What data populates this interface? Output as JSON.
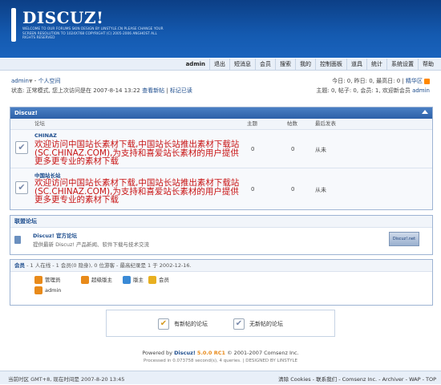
{
  "logo": {
    "text": "DISCUZ!",
    "sub": "WELCOME TO OUR FORUMS  SKIN DESIGN BY LINSTYLE.CN  PLEASE CHANGE YOUR SCREEN RESOLUTION TO 1024X768  COPYRIGHT (C) 2005-2006 ANGHOST ALL RIGHTS RESERVED"
  },
  "topnav": [
    "admin",
    "退出",
    "短消息",
    "会员",
    "搜索",
    "我的",
    "控制面板",
    "道具",
    "统计",
    "系统设置",
    "帮助"
  ],
  "user": {
    "name": "admin",
    "space": "个人空间",
    "status": "状态: 正常模式, 您上次访问是在 2007-8-14 13:22",
    "view_new": "查看新帖",
    "mark_read": "标记已读",
    "stats_today": "今日: 0, 昨日: 0, 最高日: 0",
    "fine_zone": "精华区",
    "stats_topics": "主题: 0, 帖子: 0, 会员: 1, 欢迎新会员",
    "new_member": "admin"
  },
  "category": {
    "title": "Discuz!",
    "col_forum": "论坛",
    "col_topics": "主题",
    "col_posts": "帖数",
    "col_last": "最后发表",
    "forums": [
      {
        "name": "CHINAZ",
        "desc": "欢迎访问中国站长素材下载,中国站长站推出素材下载站(SC.CHINAZ.COM),为支持和喜爱站长素材的用户提供更多更专业的素材下载",
        "topics": "0",
        "posts": "0",
        "last": "从未"
      },
      {
        "name": "中国站长站",
        "desc": "欢迎访问中国站长素材下载,中国站长站推出素材下载站(SC.CHINAZ.COM),为支持和喜爱站长素材的用户提供更多更专业的素材下载",
        "topics": "0",
        "posts": "0",
        "last": "从未"
      }
    ]
  },
  "links": {
    "title": "联盟论坛",
    "name": "Discuz! 官方论坛",
    "desc": "提供最新 Discuz! 产品新闻、软件下载与技术交流",
    "badge": "Discuz!.net"
  },
  "online": {
    "title": "会员",
    "summary": "- 1 人在线 - 1 会员(0 隐身), 0 位游客 - 最高纪录是 1 于 2002-12-16.",
    "groups": [
      {
        "label": "管理员",
        "color": "#e88a1a"
      },
      {
        "label": "超级版主",
        "color": "#e88a1a"
      },
      {
        "label": "版主",
        "color": "#3a8ad6"
      },
      {
        "label": "会员",
        "color": "#e8b020"
      }
    ],
    "users": [
      "admin"
    ]
  },
  "legend": {
    "new": "有新帖的论坛",
    "none": "无新帖的论坛"
  },
  "footer": {
    "powered_prefix": "Powered by",
    "product": "Discuz!",
    "version": "5.0.0 RC1",
    "copyright": "© 2001-2007 Comsenz Inc.",
    "processed": "Processed in 0.073758 second(s), 4 queries. | DESIGNED BY LINSTYLE"
  },
  "bottombar": {
    "time": "当前时区  GMT+8, 现在时间是  2007-8-20 13:45",
    "links": "清除  Cookies - 联系我们  - Comsenz Inc. - Archiver - WAP - TOP"
  }
}
